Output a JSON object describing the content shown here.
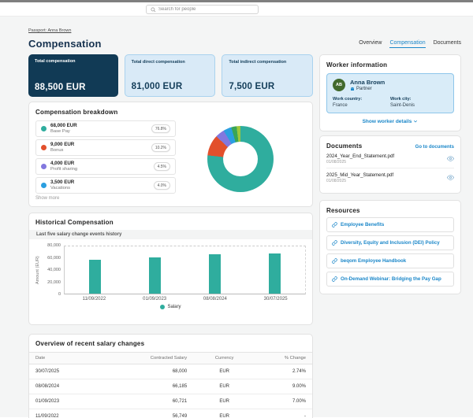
{
  "topbar": {
    "search_placeholder": "Search for people"
  },
  "breadcrumb": "Passport: Anna Brown",
  "title": "Compensation",
  "tabs": {
    "overview": "Overview",
    "compensation": "Compensation",
    "documents": "Documents"
  },
  "summary_cards": [
    {
      "label": "Total compensation",
      "value": "88,500 EUR"
    },
    {
      "label": "Total direct compensation",
      "value": "81,000 EUR"
    },
    {
      "label": "Total indirect compensation",
      "value": "7,500 EUR"
    }
  ],
  "breakdown": {
    "title": "Compensation breakdown",
    "show_more": "Show more",
    "items": [
      {
        "amount": "68,000 EUR",
        "label": "Base Pay",
        "percent": "76.8%",
        "color": "#2fad9e"
      },
      {
        "amount": "9,000 EUR",
        "label": "Bonus",
        "percent": "10.2%",
        "color": "#e2502c"
      },
      {
        "amount": "4,000 EUR",
        "label": "Profit sharing",
        "percent": "4.5%",
        "color": "#8278de"
      },
      {
        "amount": "3,500 EUR",
        "label": "Vacations",
        "percent": "4.0%",
        "color": "#2b9fe0"
      }
    ],
    "chart_data": {
      "type": "pie",
      "donut": true,
      "slices": [
        {
          "label": "Base Pay",
          "value": 68000,
          "pct": 76.8,
          "color": "#2fad9e"
        },
        {
          "label": "Bonus",
          "value": 9000,
          "pct": 10.2,
          "color": "#e2502c"
        },
        {
          "label": "Profit sharing",
          "value": 4000,
          "pct": 4.5,
          "color": "#8278de"
        },
        {
          "label": "Vacations",
          "value": 3500,
          "pct": 4.0,
          "color": "#2b9fe0"
        },
        {
          "label": "",
          "pct": 2.6,
          "color": "#3aa556"
        },
        {
          "label": "",
          "pct": 1.9,
          "color": "#9ec73c"
        }
      ]
    }
  },
  "worker": {
    "title": "Worker information",
    "initials": "AB",
    "name": "Anna Brown",
    "role": "Partner",
    "fields": [
      {
        "label": "Work country:",
        "value": "France"
      },
      {
        "label": "Work city:",
        "value": "Saint-Denis"
      }
    ],
    "details_link": "Show worker details"
  },
  "documents": {
    "title": "Documents",
    "link": "Go to documents",
    "items": [
      {
        "name": "2024_Year_End_Statement.pdf",
        "date": "01/08/2025"
      },
      {
        "name": "2025_Mid_Year_Statement.pdf",
        "date": "01/08/2025"
      }
    ]
  },
  "resources": {
    "title": "Resources",
    "links": [
      "Employee Benefits",
      "Diversity, Equity and Inclusion (DEI) Policy",
      "beqom Employee Handbook",
      "On-Demand Webinar: Bridging the Pay Gap"
    ]
  },
  "historical": {
    "title": "Historical Compensation",
    "subtitle": "Last five salary change events history",
    "chart_data": {
      "type": "bar",
      "categories": [
        "11/09/2022",
        "01/09/2023",
        "08/08/2024",
        "30/07/2025"
      ],
      "values": [
        56749,
        60721,
        66185,
        68000
      ],
      "series_name": "Salary",
      "ylabel": "Amount (EUR)",
      "ylim": [
        0,
        80000
      ],
      "yticks": [
        0,
        20000,
        40000,
        60000,
        80000
      ],
      "bar_color": "#2fad9e",
      "legend_position": "bottom"
    }
  },
  "salary_table": {
    "title": "Overview of recent salary changes",
    "columns": [
      "Date",
      "Contracted Salary",
      "Currency",
      "% Change"
    ],
    "rows": [
      [
        "30/07/2025",
        "68,000",
        "EUR",
        "2.74%"
      ],
      [
        "08/08/2024",
        "66,185",
        "EUR",
        "9.00%"
      ],
      [
        "01/09/2023",
        "60,721",
        "EUR",
        "7.00%"
      ],
      [
        "11/09/2022",
        "56,749",
        "EUR",
        "-"
      ]
    ]
  }
}
